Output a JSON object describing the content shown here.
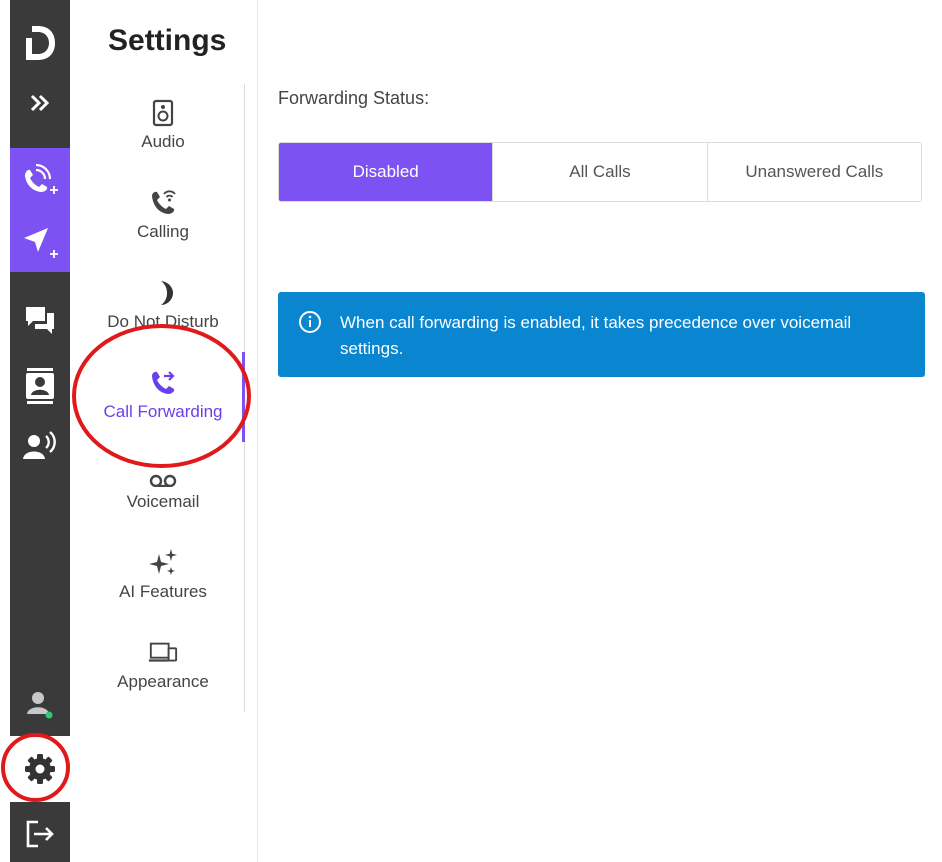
{
  "rail": {
    "logo": "D",
    "items": [
      {
        "name": "expand",
        "icon": "double-chevron-right-icon"
      },
      {
        "name": "new-call",
        "icon": "phone-plus-icon"
      },
      {
        "name": "new-message",
        "icon": "send-plus-icon"
      },
      {
        "name": "messages",
        "icon": "chat-bubbles-icon"
      },
      {
        "name": "contacts",
        "icon": "contact-card-icon"
      },
      {
        "name": "voice",
        "icon": "person-speaking-icon"
      },
      {
        "name": "profile",
        "icon": "user-status-icon"
      },
      {
        "name": "settings",
        "icon": "gear-icon"
      },
      {
        "name": "logout",
        "icon": "exit-icon"
      }
    ],
    "accent_color": "#7c52f3",
    "background_color": "#3a3a3a"
  },
  "settings": {
    "title": "Settings",
    "nav": [
      {
        "label": "Audio",
        "icon": "speaker-icon"
      },
      {
        "label": "Calling",
        "icon": "phone-wifi-icon"
      },
      {
        "label": "Do Not Disturb",
        "icon": "moon-icon"
      },
      {
        "label": "Call Forwarding",
        "icon": "phone-forward-icon",
        "active": true
      },
      {
        "label": "Voicemail",
        "icon": "voicemail-icon"
      },
      {
        "label": "AI Features",
        "icon": "sparkles-icon"
      },
      {
        "label": "Appearance",
        "icon": "devices-icon"
      }
    ]
  },
  "main": {
    "forwarding_status_label": "Forwarding Status:",
    "options": [
      "Disabled",
      "All Calls",
      "Unanswered Calls"
    ],
    "selected_option": "Disabled",
    "info": "When call forwarding is enabled, it takes precedence over voicemail settings.",
    "info_color": "#0a86d1"
  }
}
